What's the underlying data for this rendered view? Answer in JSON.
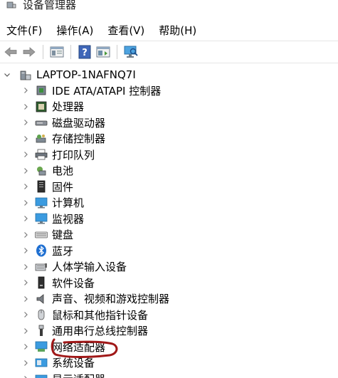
{
  "window": {
    "title": "设备管理器"
  },
  "menu": [
    "文件(F)",
    "操作(A)",
    "查看(V)",
    "帮助(H)"
  ],
  "toolbar": {
    "icons": [
      "back-arrow-icon",
      "forward-arrow-icon",
      "properties-panel-icon",
      "help-icon",
      "update-driver-icon",
      "scan-hardware-icon"
    ]
  },
  "tree": {
    "root": {
      "label": "LAPTOP-1NAFNQ7I",
      "icon": "computer-icon"
    },
    "items": [
      {
        "label": "IDE ATA/ATAPI 控制器",
        "icon": "ide-controller-icon"
      },
      {
        "label": "处理器",
        "icon": "processor-icon"
      },
      {
        "label": "磁盘驱动器",
        "icon": "disk-drive-icon"
      },
      {
        "label": "存储控制器",
        "icon": "storage-controller-icon"
      },
      {
        "label": "打印队列",
        "icon": "printer-icon"
      },
      {
        "label": "电池",
        "icon": "battery-icon"
      },
      {
        "label": "固件",
        "icon": "firmware-icon"
      },
      {
        "label": "计算机",
        "icon": "computer-monitor-icon"
      },
      {
        "label": "监视器",
        "icon": "monitor-icon"
      },
      {
        "label": "键盘",
        "icon": "keyboard-icon"
      },
      {
        "label": "蓝牙",
        "icon": "bluetooth-icon"
      },
      {
        "label": "人体学输入设备",
        "icon": "hid-icon"
      },
      {
        "label": "软件设备",
        "icon": "software-device-icon"
      },
      {
        "label": "声音、视频和游戏控制器",
        "icon": "speaker-icon"
      },
      {
        "label": "鼠标和其他指针设备",
        "icon": "mouse-icon"
      },
      {
        "label": "通用串行总线控制器",
        "icon": "usb-icon"
      },
      {
        "label": "网络适配器",
        "icon": "network-adapter-icon"
      },
      {
        "label": "系统设备",
        "icon": "system-device-icon"
      },
      {
        "label": "显示适配器",
        "icon": "display-adapter-icon"
      }
    ]
  },
  "colors": {
    "annotation": "#a01818",
    "chevron": "#7a7a7a"
  }
}
